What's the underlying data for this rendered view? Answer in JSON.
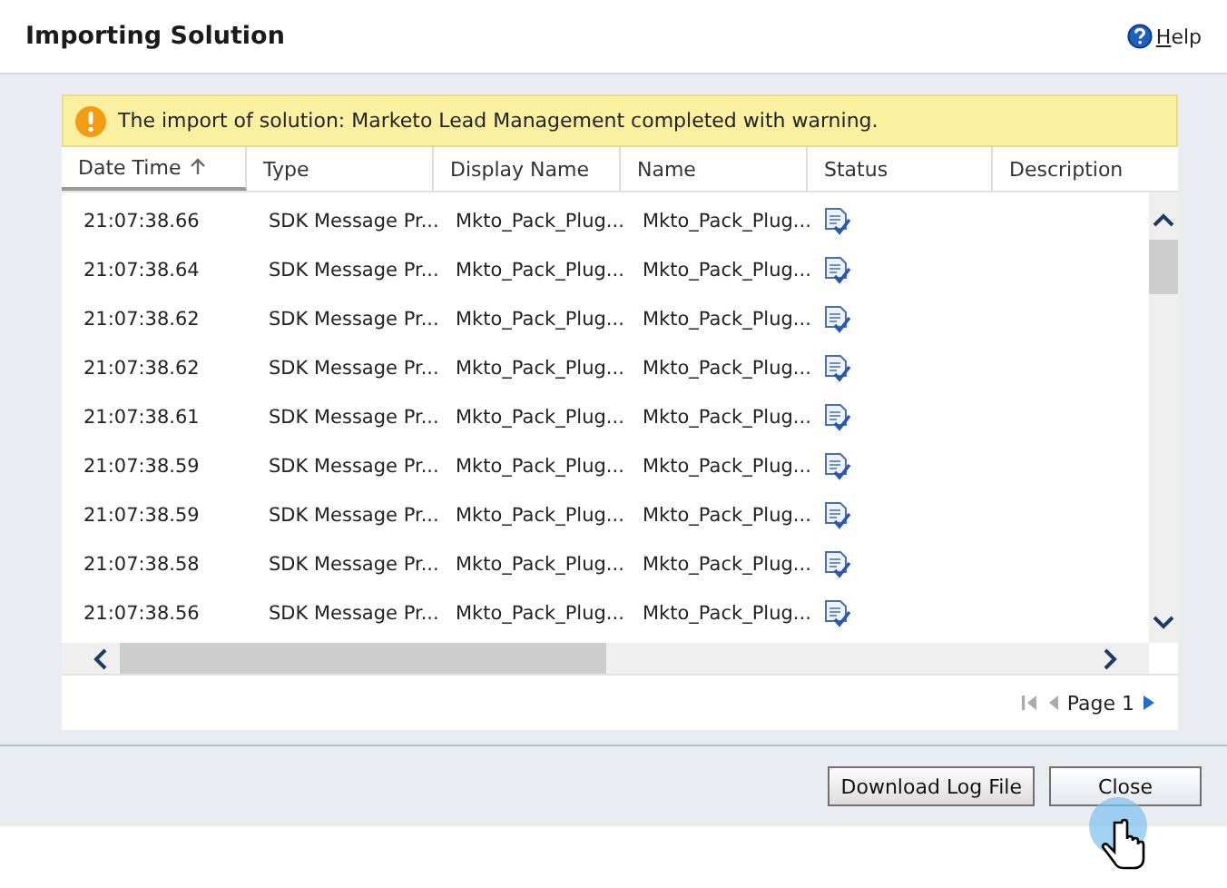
{
  "window": {
    "title": "Importing Solution",
    "help": "Help"
  },
  "notification": {
    "kind": "warning",
    "text": "The import of solution: Marketo Lead Management completed with warning."
  },
  "table": {
    "columns": [
      {
        "label": "Date Time",
        "sorted": true
      },
      {
        "label": "Type",
        "sorted": false
      },
      {
        "label": "Display Name",
        "sorted": false
      },
      {
        "label": "Name",
        "sorted": false
      },
      {
        "label": "Status",
        "sorted": false
      },
      {
        "label": "Description",
        "sorted": false
      }
    ],
    "rows": [
      {
        "date_time": "21:07:38.66",
        "type": "SDK Message Pr...",
        "display_name": "Mkto_Pack_Plug...",
        "name": "Mkto_Pack_Plug..."
      },
      {
        "date_time": "21:07:38.64",
        "type": "SDK Message Pr...",
        "display_name": "Mkto_Pack_Plug...",
        "name": "Mkto_Pack_Plug..."
      },
      {
        "date_time": "21:07:38.62",
        "type": "SDK Message Pr...",
        "display_name": "Mkto_Pack_Plug...",
        "name": "Mkto_Pack_Plug..."
      },
      {
        "date_time": "21:07:38.62",
        "type": "SDK Message Pr...",
        "display_name": "Mkto_Pack_Plug...",
        "name": "Mkto_Pack_Plug..."
      },
      {
        "date_time": "21:07:38.61",
        "type": "SDK Message Pr...",
        "display_name": "Mkto_Pack_Plug...",
        "name": "Mkto_Pack_Plug..."
      },
      {
        "date_time": "21:07:38.59",
        "type": "SDK Message Pr...",
        "display_name": "Mkto_Pack_Plug...",
        "name": "Mkto_Pack_Plug..."
      },
      {
        "date_time": "21:07:38.59",
        "type": "SDK Message Pr...",
        "display_name": "Mkto_Pack_Plug...",
        "name": "Mkto_Pack_Plug..."
      },
      {
        "date_time": "21:07:38.58",
        "type": "SDK Message Pr...",
        "display_name": "Mkto_Pack_Plug...",
        "name": "Mkto_Pack_Plug..."
      },
      {
        "date_time": "21:07:38.56",
        "type": "SDK Message Pr...",
        "display_name": "Mkto_Pack_Plug...",
        "name": "Mkto_Pack_Plug..."
      }
    ]
  },
  "pager": {
    "page": "Page 1"
  },
  "buttons": [
    {
      "label": "Download Log File",
      "hovered": false
    },
    {
      "label": "Close",
      "hovered": true
    }
  ]
}
